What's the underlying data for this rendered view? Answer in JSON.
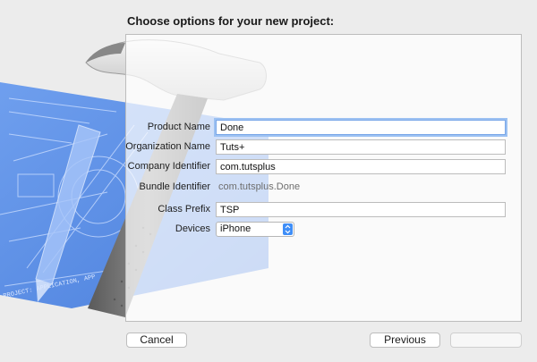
{
  "dialog": {
    "heading": "Choose options for your new project:"
  },
  "form": {
    "product_name": {
      "label": "Product Name",
      "value": "Done"
    },
    "organization_name": {
      "label": "Organization Name",
      "value": "Tuts+"
    },
    "company_identifier": {
      "label": "Company Identifier",
      "value": "com.tutsplus"
    },
    "bundle_identifier": {
      "label": "Bundle Identifier",
      "value": "com.tutsplus.Done"
    },
    "class_prefix": {
      "label": "Class Prefix",
      "value": "TSP"
    },
    "devices": {
      "label": "Devices",
      "value": "iPhone"
    }
  },
  "buttons": {
    "cancel": "Cancel",
    "previous": "Previous",
    "next": ""
  },
  "artwork": {
    "blueprint_caption": "PROJECT: APPLICATION, APP",
    "icon": "xcode-hammer-blueprint"
  },
  "colors": {
    "blueprint": "#5b8fe6",
    "focus_ring": "#9cc1f2",
    "stepper": "#3f8ef7"
  }
}
